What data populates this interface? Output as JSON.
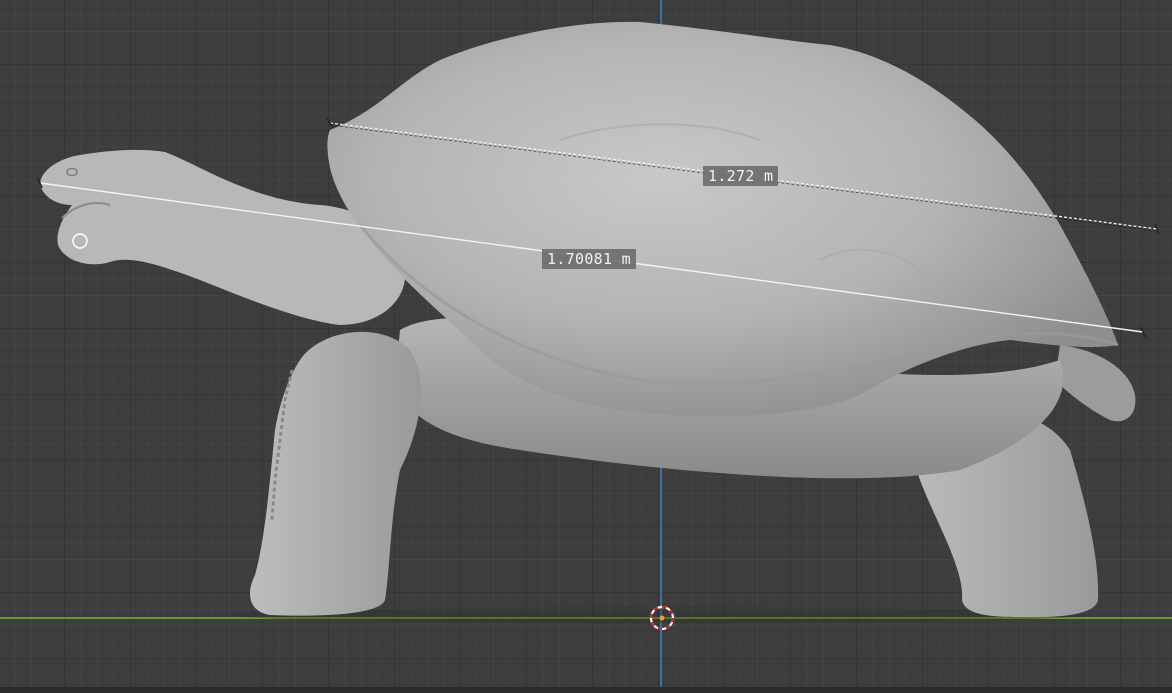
{
  "viewport": {
    "axis_x_color": "#6a9a2e",
    "axis_z_color": "#3b6ea8",
    "background": "#3d3d3d",
    "model": "tortoise-mesh"
  },
  "measurements": [
    {
      "label": "1.272 m",
      "style": "dashed"
    },
    {
      "label": "1.70081 m",
      "style": "solid"
    }
  ],
  "icons": {
    "cursor": "3d-cursor-icon",
    "point": "measure-point-icon"
  }
}
